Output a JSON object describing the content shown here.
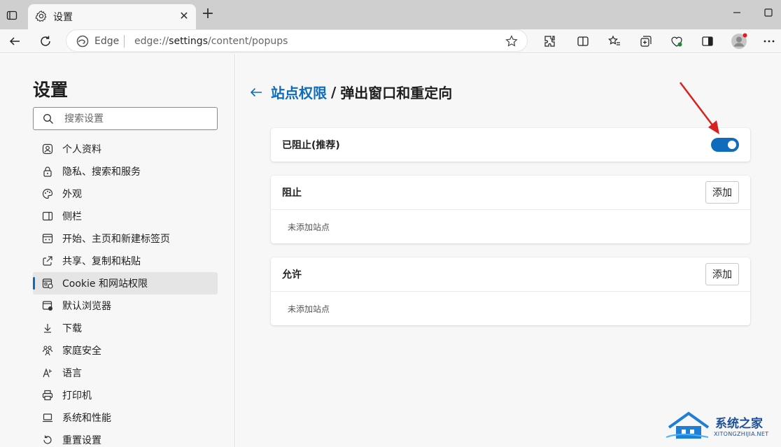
{
  "tab": {
    "title": "设置"
  },
  "toolbar": {
    "address_site": "Edge",
    "address_url_prefix": "edge://",
    "address_url_host": "settings",
    "address_url_path": "/content/popups"
  },
  "sidebar": {
    "title": "设置",
    "search_placeholder": "搜索设置",
    "items": [
      {
        "label": "个人资料",
        "icon": "profile-icon"
      },
      {
        "label": "隐私、搜索和服务",
        "icon": "lock-icon"
      },
      {
        "label": "外观",
        "icon": "palette-icon"
      },
      {
        "label": "侧栏",
        "icon": "sidebar-icon"
      },
      {
        "label": "开始、主页和新建标签页",
        "icon": "home-icon"
      },
      {
        "label": "共享、复制和粘贴",
        "icon": "share-icon"
      },
      {
        "label": "Cookie 和网站权限",
        "icon": "site-permissions-icon",
        "active": true
      },
      {
        "label": "默认浏览器",
        "icon": "browser-icon"
      },
      {
        "label": "下载",
        "icon": "download-icon"
      },
      {
        "label": "家庭安全",
        "icon": "family-icon"
      },
      {
        "label": "语言",
        "icon": "language-icon"
      },
      {
        "label": "打印机",
        "icon": "printer-icon"
      },
      {
        "label": "系统和性能",
        "icon": "laptop-icon"
      },
      {
        "label": "重置设置",
        "icon": "reset-icon"
      }
    ]
  },
  "content": {
    "breadcrumb_link": "站点权限",
    "breadcrumb_sep": "/",
    "breadcrumb_current": "弹出窗口和重定向",
    "blocked_label": "已阻止(推荐)",
    "blocked_toggle_on": true,
    "block_section": {
      "title": "阻止",
      "add_label": "添加",
      "empty_text": "未添加站点"
    },
    "allow_section": {
      "title": "允许",
      "add_label": "添加",
      "empty_text": "未添加站点"
    }
  },
  "watermark": {
    "text": "系统之家",
    "sub": "XITONGZHIJIA.NET"
  },
  "colors": {
    "accent": "#0f6cbd",
    "arrow": "#d9201f",
    "watermark": "#1d4f9a"
  }
}
